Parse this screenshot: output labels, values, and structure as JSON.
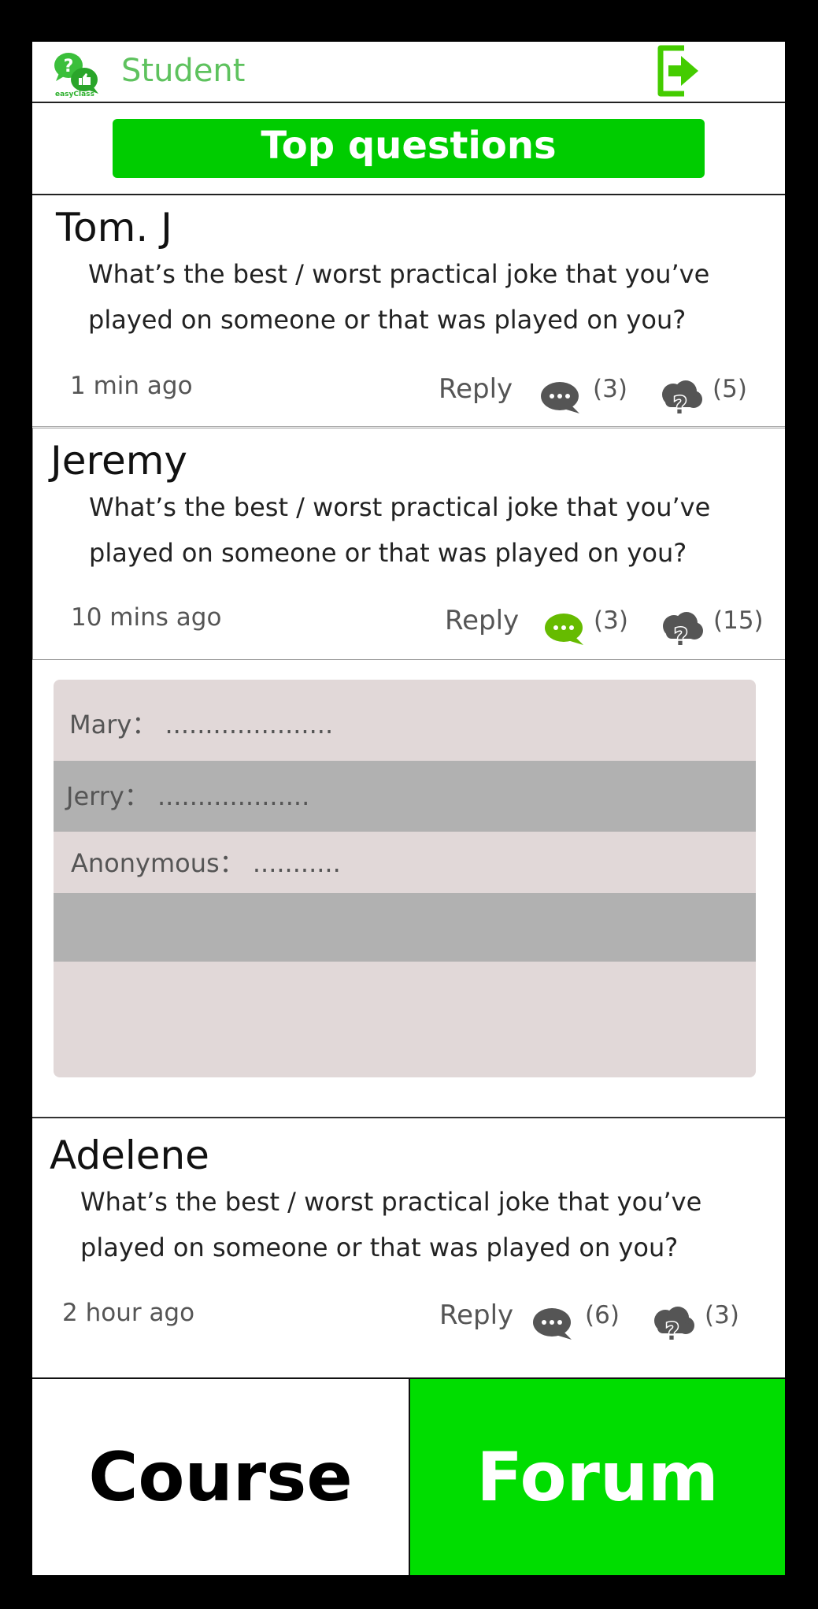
{
  "header": {
    "role": "Student",
    "logo_text": "easyClass"
  },
  "top_questions_label": "Top questions",
  "questions": [
    {
      "author": "Tom. J",
      "text": "What’s the best / worst practical joke that you’ve played on someone or that was played on you?",
      "time": "1 min ago",
      "reply_label": "Reply",
      "comments": "(3)",
      "questions_count": "(5)"
    },
    {
      "author": "Jeremy",
      "text": "What’s the best / worst practical joke that you’ve played on someone or that was played on you?",
      "time": "10 mins ago",
      "reply_label": "Reply",
      "comments": "(3)",
      "questions_count": "(15)"
    },
    {
      "author": "Adelene",
      "text": "What’s the best / worst practical joke that you’ve played on someone or that was played on you?",
      "time": "2 hour ago",
      "reply_label": "Reply",
      "comments": "(6)",
      "questions_count": "(3)"
    }
  ],
  "replies": [
    {
      "name": "Mary：",
      "text": "....................."
    },
    {
      "name": "Jerry：",
      "text": "..................."
    },
    {
      "name": "Anonymous：",
      "text": "..........."
    }
  ],
  "nav": {
    "course": "Course",
    "forum": "Forum"
  },
  "colors": {
    "accent_green": "#00cc00",
    "active_comment": "#66bb00",
    "icon_gray": "#555555"
  },
  "icons": {
    "logo": "easyclass-logo-icon",
    "logout": "logout-icon",
    "comment": "comment-bubble-icon",
    "question_cloud": "question-cloud-icon"
  }
}
